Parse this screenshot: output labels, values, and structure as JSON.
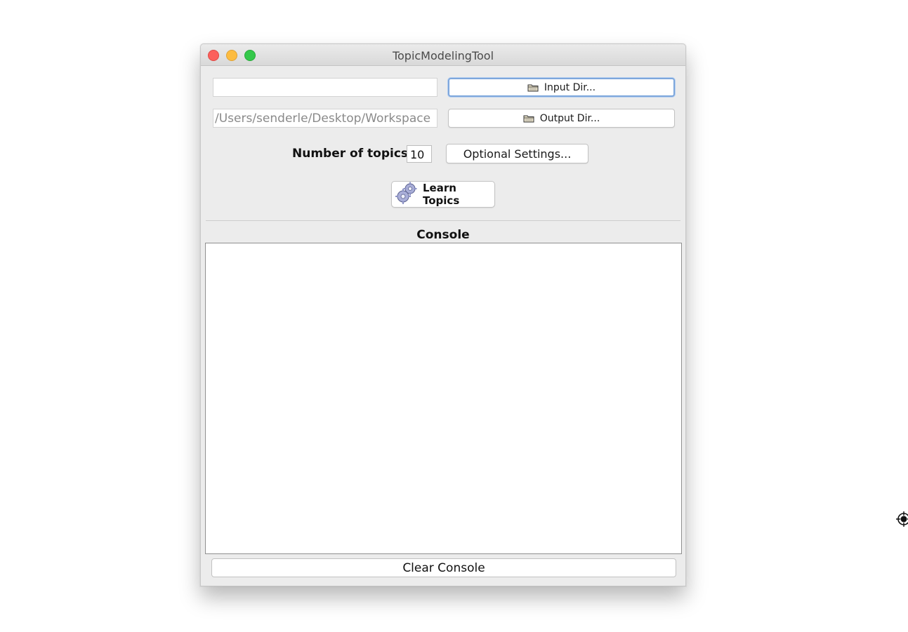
{
  "window": {
    "title": "TopicModelingTool"
  },
  "input": {
    "path_value": "",
    "button_label": "Input Dir..."
  },
  "output": {
    "path_value": "/Users/senderle/Desktop/Workspace",
    "button_label": "Output Dir..."
  },
  "topics": {
    "label": "Number of topics:",
    "value": "10",
    "settings_button_label": "Optional Settings..."
  },
  "learn": {
    "button_label": "Learn Topics"
  },
  "console": {
    "title": "Console",
    "content": "",
    "clear_button_label": "Clear Console"
  },
  "icons": {
    "folder": "folder-icon",
    "gears": "gears-icon",
    "close": "close-icon",
    "minimize": "minimize-icon",
    "maximize": "maximize-icon",
    "edge": "crosshair-icon"
  },
  "colors": {
    "close": "#fc605c",
    "minimize": "#fdbc40",
    "maximize": "#34c84a",
    "focus_ring": "#7ea7dc"
  }
}
